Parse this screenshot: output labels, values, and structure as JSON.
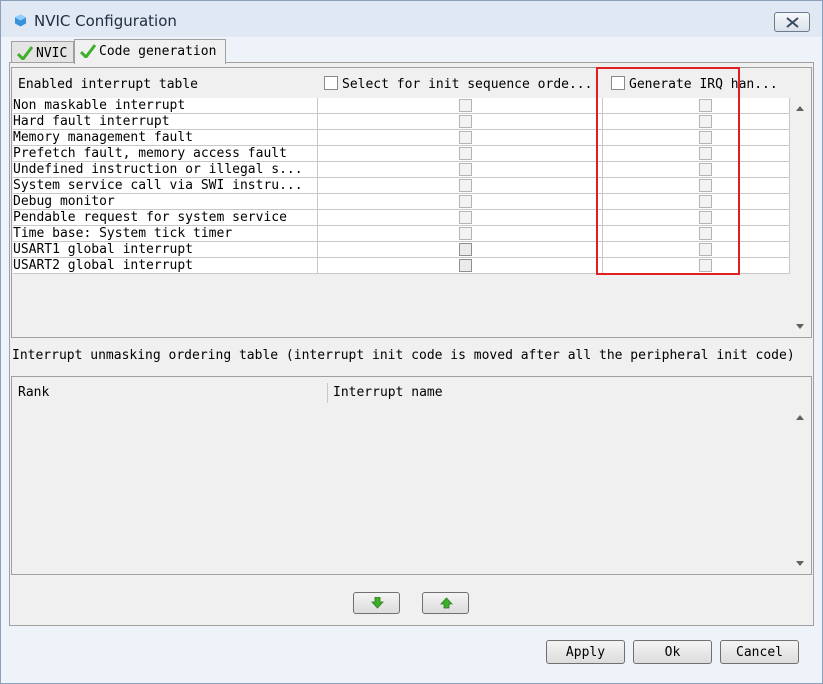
{
  "window": {
    "title": "NVIC Configuration"
  },
  "tabs": [
    {
      "label": "NVIC"
    },
    {
      "label": "Code generation"
    }
  ],
  "enabled_table": {
    "headers": {
      "name": "Enabled interrupt table",
      "select_init": "Select for init sequence orde...",
      "generate_irq": "Generate IRQ han..."
    },
    "rows": [
      {
        "name": "Non maskable interrupt"
      },
      {
        "name": "Hard fault interrupt"
      },
      {
        "name": "Memory management fault"
      },
      {
        "name": "Prefetch fault, memory access fault"
      },
      {
        "name": "Undefined instruction or illegal s..."
      },
      {
        "name": "System service call via SWI instru..."
      },
      {
        "name": "Debug monitor"
      },
      {
        "name": "Pendable request for system service"
      },
      {
        "name": "Time base: System tick timer"
      },
      {
        "name": "USART1 global interrupt"
      },
      {
        "name": "USART2 global interrupt"
      }
    ]
  },
  "ordering": {
    "caption": "Interrupt unmasking ordering table (interrupt init code is moved after all the peripheral init code)",
    "headers": {
      "rank": "Rank",
      "name": "Interrupt name"
    }
  },
  "buttons": {
    "apply": "Apply",
    "ok": "Ok",
    "cancel": "Cancel"
  },
  "icons": {
    "app": "cube-icon",
    "close": "close-icon",
    "tab_check": "green-check-icon",
    "move_down": "green-arrow-down-icon",
    "move_up": "green-arrow-up-icon"
  },
  "colors": {
    "highlight": "#e02020",
    "check": "#3fae2a"
  }
}
